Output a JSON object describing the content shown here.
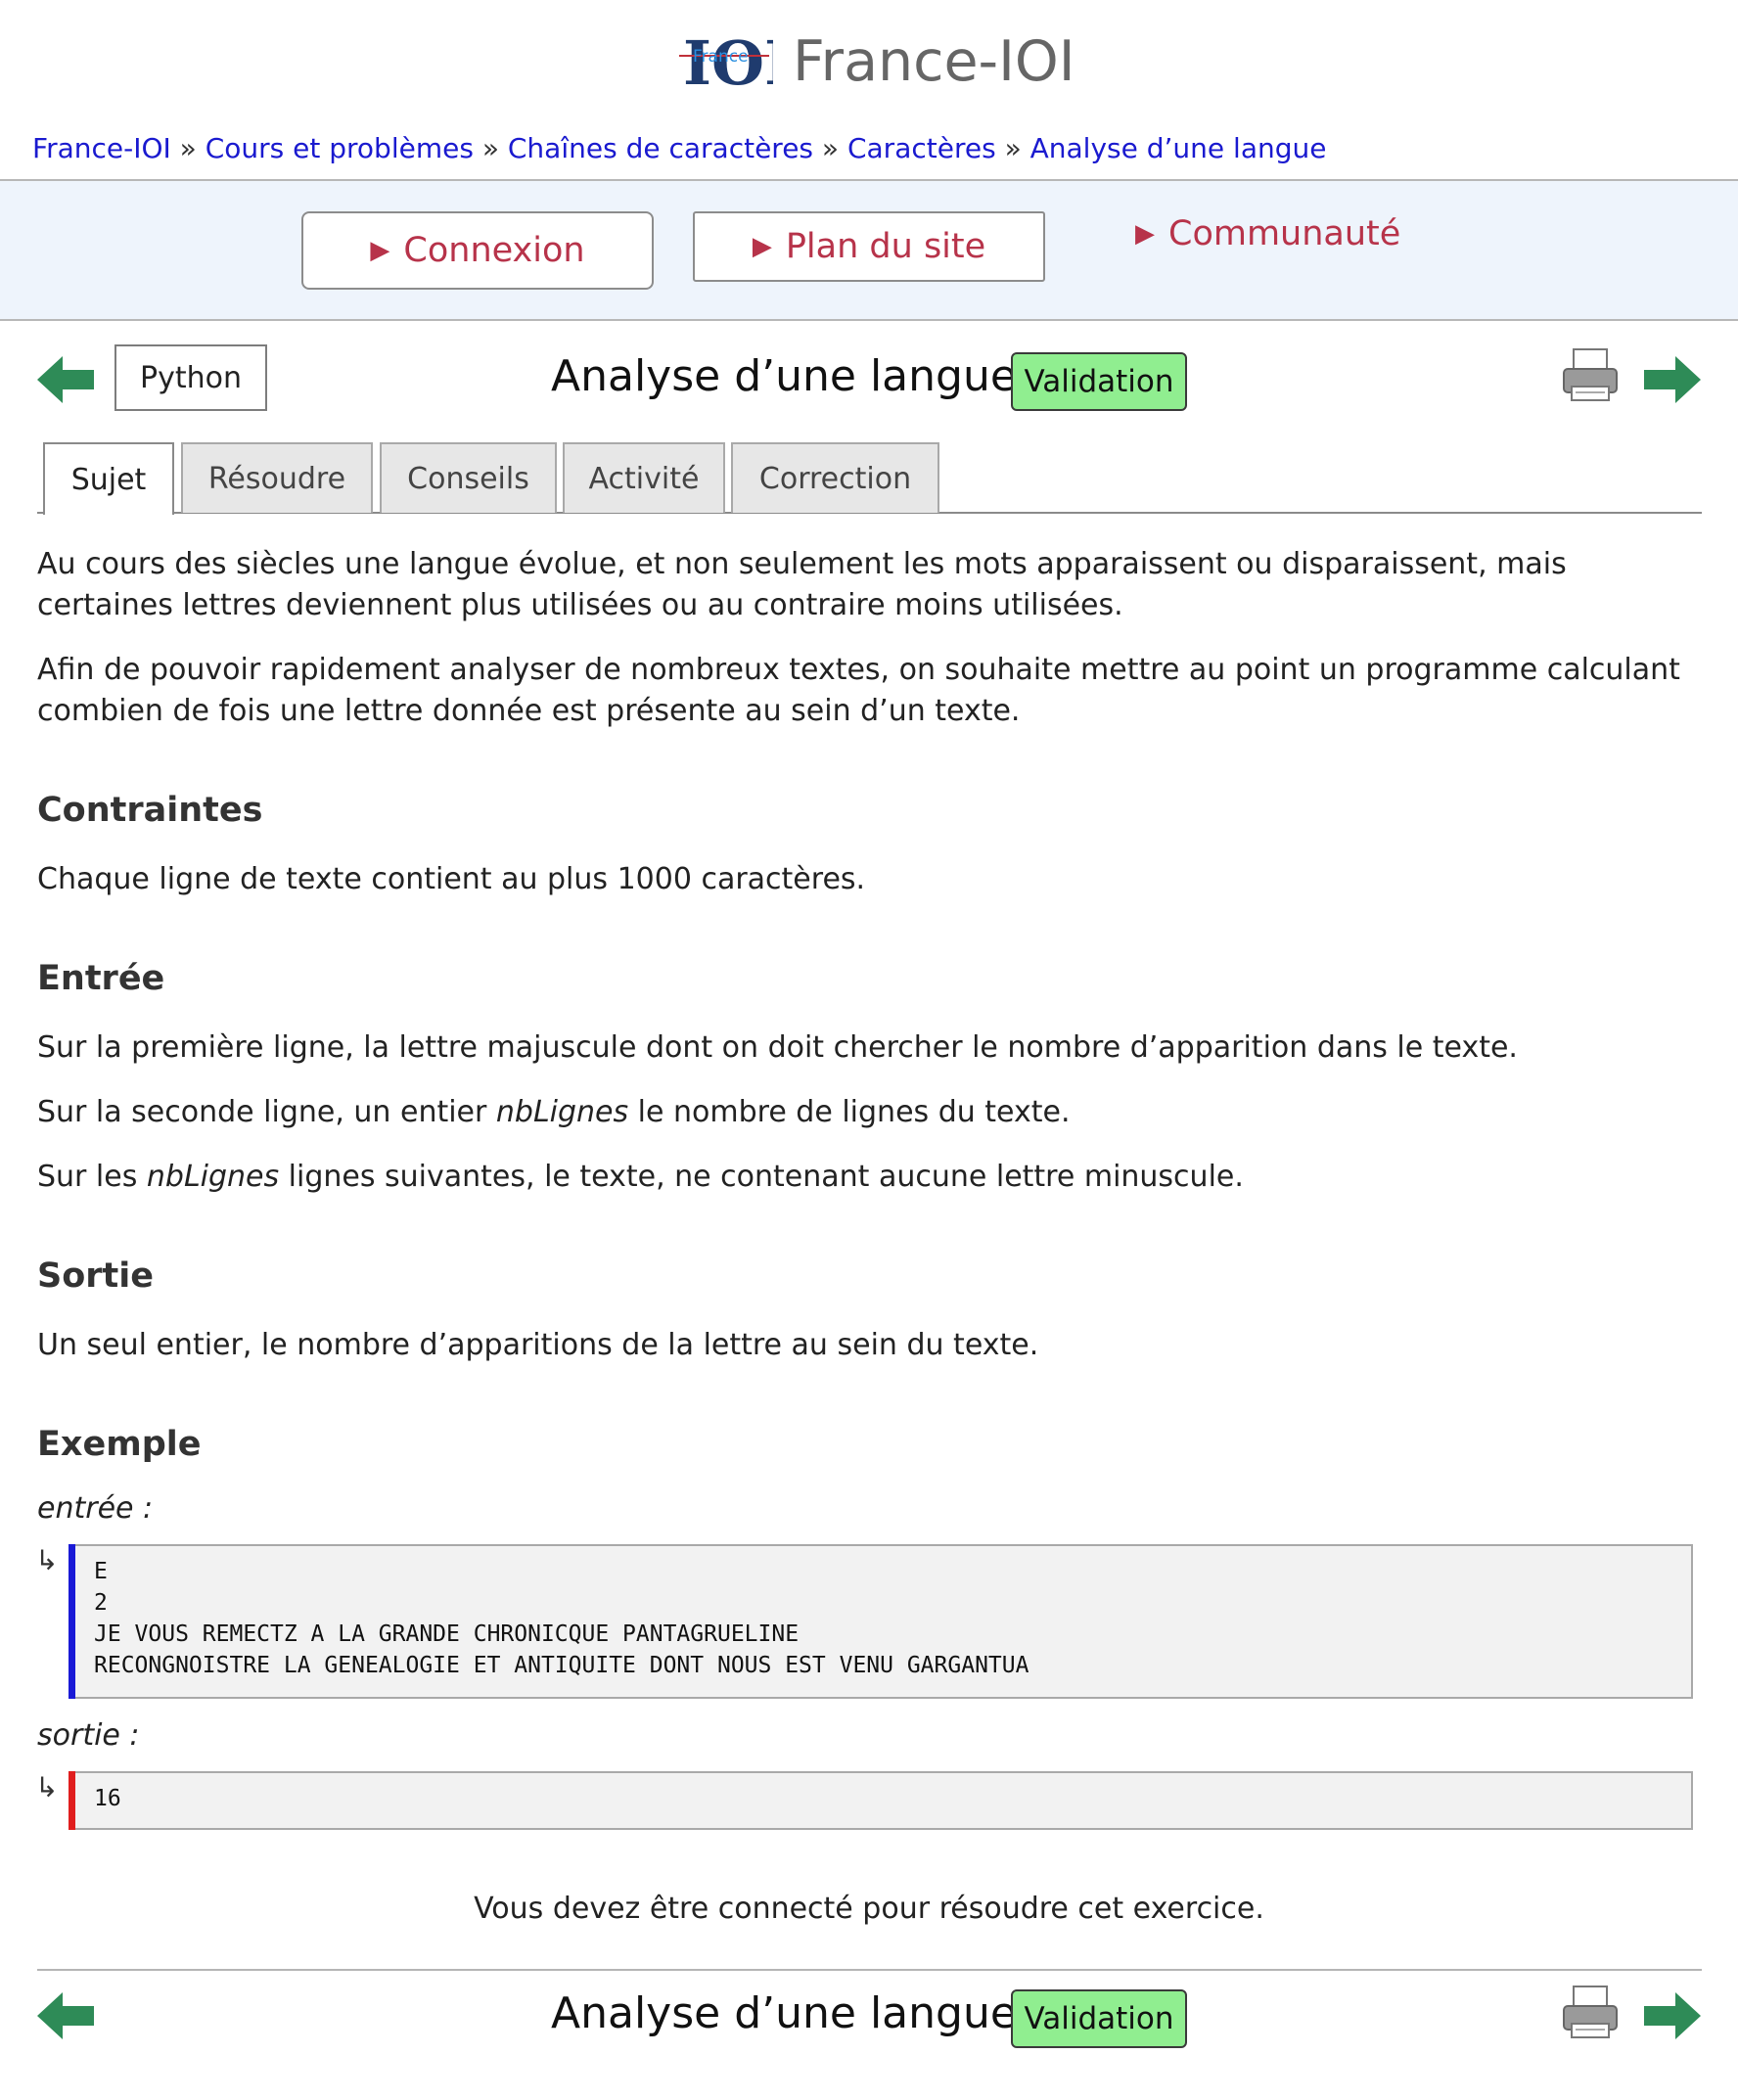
{
  "header": {
    "logo_text": "IOI",
    "logo_subtext": "France",
    "site_title": "France-IOI"
  },
  "breadcrumb": {
    "items": [
      "France-IOI",
      "Cours et problèmes",
      "Chaînes de caractères",
      "Caractères",
      "Analyse d’une langue"
    ],
    "separator": "»"
  },
  "menu": {
    "connexion": "Connexion",
    "plan": "Plan du site",
    "communaute": "Communauté",
    "marker": "▶"
  },
  "task": {
    "language": "Python",
    "title": "Analyse d’une langue",
    "validation": "Validation"
  },
  "tabs": [
    "Sujet",
    "Résoudre",
    "Conseils",
    "Activité",
    "Correction"
  ],
  "active_tab": "Sujet",
  "content": {
    "intro1": "Au cours des siècles une langue évolue, et non seulement les mots apparaissent ou disparaissent, mais certaines lettres deviennent plus utilisées ou au contraire moins utilisées.",
    "intro2": "Afin de pouvoir rapidement analyser de nombreux textes, on souhaite mettre au point un programme calculant combien de fois une lettre donnée est présente au sein d’un texte.",
    "contraintes_heading": "Contraintes",
    "contraintes_text": "Chaque ligne de texte contient au plus 1000 caractères.",
    "entree_heading": "Entrée",
    "entree_line1": "Sur la première ligne, la lettre majuscule dont on doit chercher le nombre d’apparition dans le texte.",
    "entree_line2_a": "Sur la seconde ligne, un entier ",
    "entree_line2_var": "nbLignes",
    "entree_line2_b": " le nombre de lignes du texte.",
    "entree_line3_a": "Sur les ",
    "entree_line3_var": "nbLignes",
    "entree_line3_b": " lignes suivantes, le texte, ne contenant aucune lettre minuscule.",
    "sortie_heading": "Sortie",
    "sortie_text": "Un seul entier, le nombre d’apparitions de la lettre au sein du texte.",
    "exemple_heading": "Exemple",
    "input_label": "entrée :",
    "input_lines": [
      "E",
      "2",
      "JE VOUS REMECTZ A LA GRANDE CHRONICQUE PANTAGRUELINE",
      "RECONGNOISTRE LA GENEALOGIE ET ANTIQUITE DONT NOUS EST VENU GARGANTUA"
    ],
    "output_label": "sortie :",
    "output_lines": [
      "16"
    ],
    "enter_glyph": "↳",
    "connect_message": "Vous devez être connecté pour résoudre cet exercice."
  },
  "icons": {
    "prev": "arrow-left-icon",
    "next": "arrow-right-icon",
    "print": "printer-icon"
  },
  "colors": {
    "link": "#1a1acf",
    "menu_text": "#b7334a",
    "menu_band": "#eef4fc",
    "validation_bg": "#90ee90",
    "arrow_green": "#2e8b57",
    "input_bar": "#1a1ad6",
    "output_bar": "#e01e1e"
  }
}
